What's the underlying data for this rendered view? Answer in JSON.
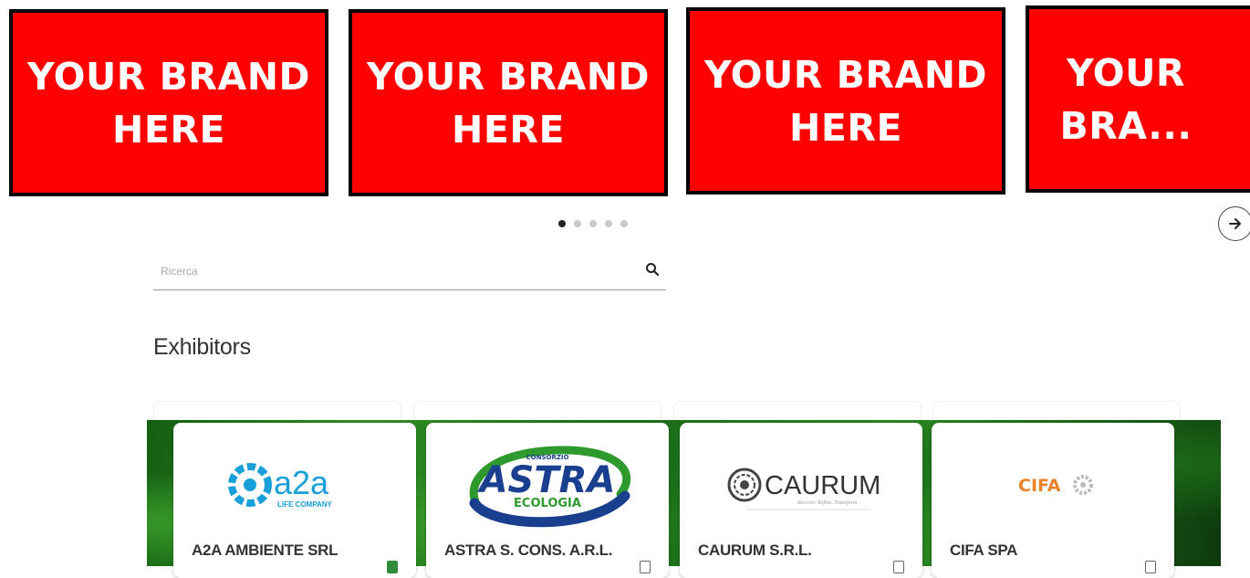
{
  "banners": [
    {
      "line1": "YOUR BRAND",
      "line2": "HERE"
    },
    {
      "line1": "YOUR BRAND",
      "line2": "HERE"
    },
    {
      "line1": "YOUR BRAND",
      "line2": "HERE"
    },
    {
      "line1": "YOUR",
      "line2": "BRA..."
    }
  ],
  "carousel": {
    "page_count": 5,
    "active_index": 0
  },
  "search": {
    "placeholder": "Ricerca",
    "value": ""
  },
  "section": {
    "title": "Exhibitors"
  },
  "exhibitors": [
    {
      "name": "A2A AMBIENTE SRL",
      "logo_text": "a2a",
      "logo_subtext": "LIFE COMPANY",
      "saved": true
    },
    {
      "name": "ASTRA S. CONS. A.R.L.",
      "logo_top": "CONSORZIO",
      "logo_text": "ASTRA",
      "logo_subtext": "ECOLOGIA",
      "saved": false
    },
    {
      "name": "CAURUM S.R.L.",
      "logo_text": "CAURUM",
      "logo_subtext": "Recover. Refine. Transform",
      "saved": false
    },
    {
      "name": "CIFA SPA",
      "logo_text": "CIFA",
      "saved": false
    }
  ],
  "colors": {
    "brand_red": "#ff0000",
    "band_green": "#2f8d22",
    "a2a_blue": "#1aa0d8",
    "astra_blue": "#1a3f8f",
    "astra_green": "#2e9a2e",
    "cifa_orange": "#e8822a"
  }
}
